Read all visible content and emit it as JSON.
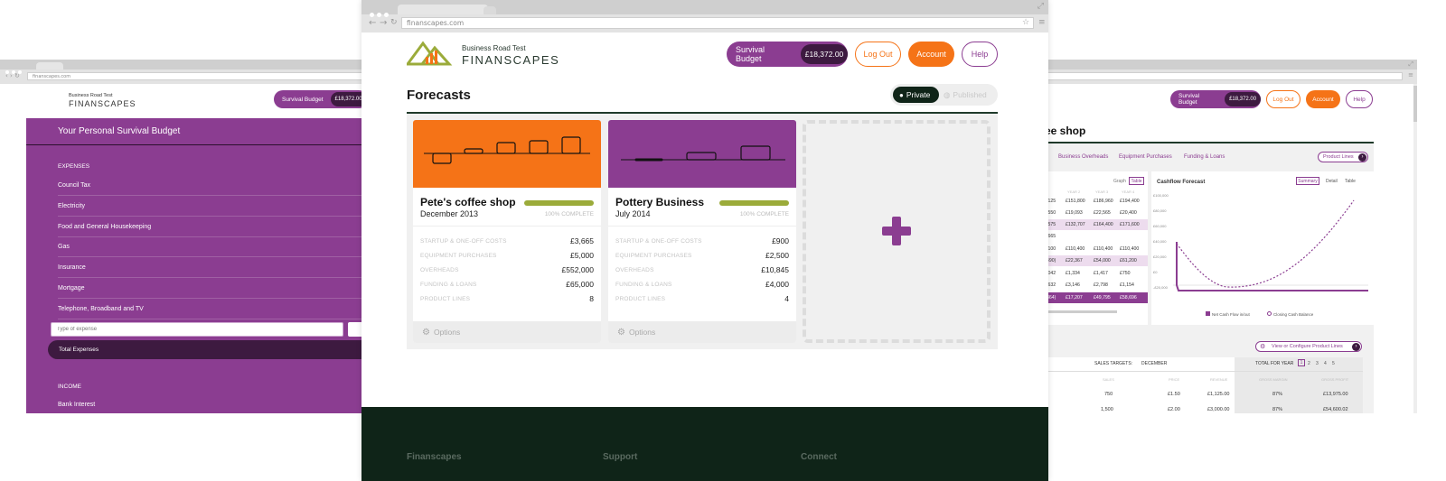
{
  "browser": {
    "url": "finanscapes.com",
    "small_url": "finanscapes.com"
  },
  "brand": {
    "tagline": "Business Road Test",
    "name": "FINANSCAPES"
  },
  "nav": {
    "survival_budget_label": "Survival Budget",
    "survival_budget_amount": "£18,372.00",
    "logout_label": "Log Out",
    "account_label": "Account",
    "help_label": "Help"
  },
  "forecasts": {
    "title": "Forecasts",
    "toggle_private": "Private",
    "toggle_published": "Published",
    "cards": [
      {
        "title": "Pete's coffee shop",
        "date": "December 2013",
        "complete": "100% COMPLETE",
        "stats": [
          {
            "label": "STARTUP & ONE-OFF COSTS",
            "value": "£3,665"
          },
          {
            "label": "EQUIPMENT PURCHASES",
            "value": "£5,000"
          },
          {
            "label": "OVERHEADS",
            "value": "£552,000"
          },
          {
            "label": "FUNDING & LOANS",
            "value": "£65,000"
          },
          {
            "label": "PRODUCT LINES",
            "value": "8"
          }
        ],
        "options": "Options"
      },
      {
        "title": "Pottery Business",
        "date": "July 2014",
        "complete": "100% COMPLETE",
        "stats": [
          {
            "label": "STARTUP & ONE-OFF COSTS",
            "value": "£900"
          },
          {
            "label": "EQUIPMENT PURCHASES",
            "value": "£2,500"
          },
          {
            "label": "OVERHEADS",
            "value": "£10,845"
          },
          {
            "label": "FUNDING & LOANS",
            "value": "£4,000"
          },
          {
            "label": "PRODUCT LINES",
            "value": "4"
          }
        ],
        "options": "Options"
      }
    ]
  },
  "footer": {
    "col1": "Finanscapes",
    "col2": "Support",
    "col3": "Connect"
  },
  "left_panel": {
    "title": "Your Personal Survival Budget",
    "expenses_heading": "EXPENSES",
    "expense_items": [
      "Council Tax",
      "Electricity",
      "Food and General Housekeeping",
      "Gas",
      "Insurance",
      "Mortgage",
      "Telephone, Broadband and TV"
    ],
    "type_placeholder": "Type of expense",
    "total_label": "Total Expenses",
    "income_heading": "INCOME",
    "income_items": [
      "Bank Interest"
    ]
  },
  "right_panel": {
    "title": "ee shop",
    "tabs": [
      "Business Overheads",
      "Equipment Purchases",
      "Funding & Loans"
    ],
    "product_lines": "Product Lines",
    "graph_label": "Graph",
    "table_label": "Table",
    "cashflow_title": "Cashflow Forecast",
    "summary_label": "Summary",
    "detail_label": "Detail",
    "table2_label": "Table",
    "col_headers": [
      "YEAR 1",
      "YEAR 2",
      "YEAR 3",
      "YEAR 4"
    ],
    "rows": [
      [
        ",125",
        "£151,800",
        "£186,960",
        "£194,400"
      ],
      [
        ",550",
        "£19,093",
        "£22,565",
        "£20,400"
      ],
      [
        ",575",
        "£132,707",
        "£164,400",
        "£171,600"
      ],
      [
        ",665",
        "",
        "",
        ""
      ],
      [
        ",100",
        "£110,400",
        "£110,400",
        "£110,400"
      ],
      [
        "490)",
        "£22,367",
        "£54,000",
        "£61,200"
      ],
      [
        ",042",
        "£1,334",
        "£1,417",
        "£750"
      ],
      [
        ",632",
        "£3,146",
        "£2,798",
        "£1,154"
      ],
      [
        "364)",
        "£17,207",
        "£49,795",
        "£58,696"
      ]
    ],
    "y_ticks": [
      "£100,000",
      "£80,000",
      "£60,000",
      "£40,000",
      "£20,000",
      "£0",
      "-£20,000"
    ],
    "legend_net": "Net Cash Flow in/out",
    "legend_balance": "Closing Cash Balance",
    "configure_label": "View or Configure Product Lines",
    "sales_targets": "SALES TARGETS:",
    "december": "DECEMBER",
    "total_for_year": "TOTAL FOR YEAR",
    "year_pages": [
      "1",
      "2",
      "3",
      "4",
      "5"
    ],
    "sales_headers": [
      "SALES",
      "PRICE",
      "REVENUE",
      "GROSS MARGIN",
      "GROSS PROFIT"
    ],
    "sales_rows": [
      [
        "750",
        "£1.50",
        "£1,125.00",
        "87%",
        "£13,975.00"
      ],
      [
        "1,500",
        "£2.00",
        "£3,000.00",
        "87%",
        "£54,600.02"
      ]
    ]
  },
  "colors": {
    "purple": "#8b3d91",
    "orange": "#f57317",
    "dark_green": "#0f2418",
    "olive": "#9bab3a"
  },
  "icons": [
    "plus-icon",
    "gear-icon",
    "user-icon",
    "globe-icon",
    "chevron-right-icon",
    "reload-icon",
    "star-icon",
    "menu-icon"
  ]
}
